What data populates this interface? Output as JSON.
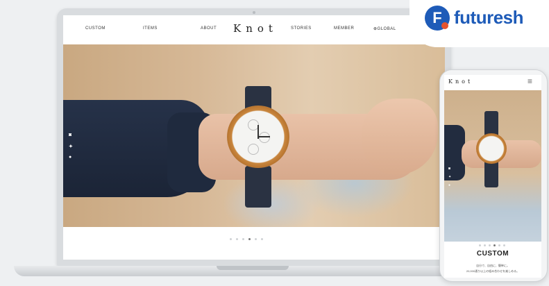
{
  "laptop": {
    "nav": {
      "custom": "CUSTOM",
      "items": "ITEMS",
      "about": "ABOUT",
      "logo": "Knot",
      "stories": "STORIES",
      "member": "MEMBER",
      "global": "⊕GLOBAL"
    },
    "carousel": {
      "slides": 6,
      "active_index": 3
    }
  },
  "phone": {
    "logo": "Knot",
    "menu_icon": "hamburger-icon",
    "section_title": "CUSTOM",
    "copy_line1": "自分で、自由に、簡単に。",
    "copy_line2": "20,000通り以上の組み合わせを楽しめる。"
  },
  "badge": {
    "letter": "F",
    "brand": "futuresh"
  },
  "colors": {
    "brand_blue": "#1e5bb8",
    "brand_orange": "#e5532e"
  }
}
